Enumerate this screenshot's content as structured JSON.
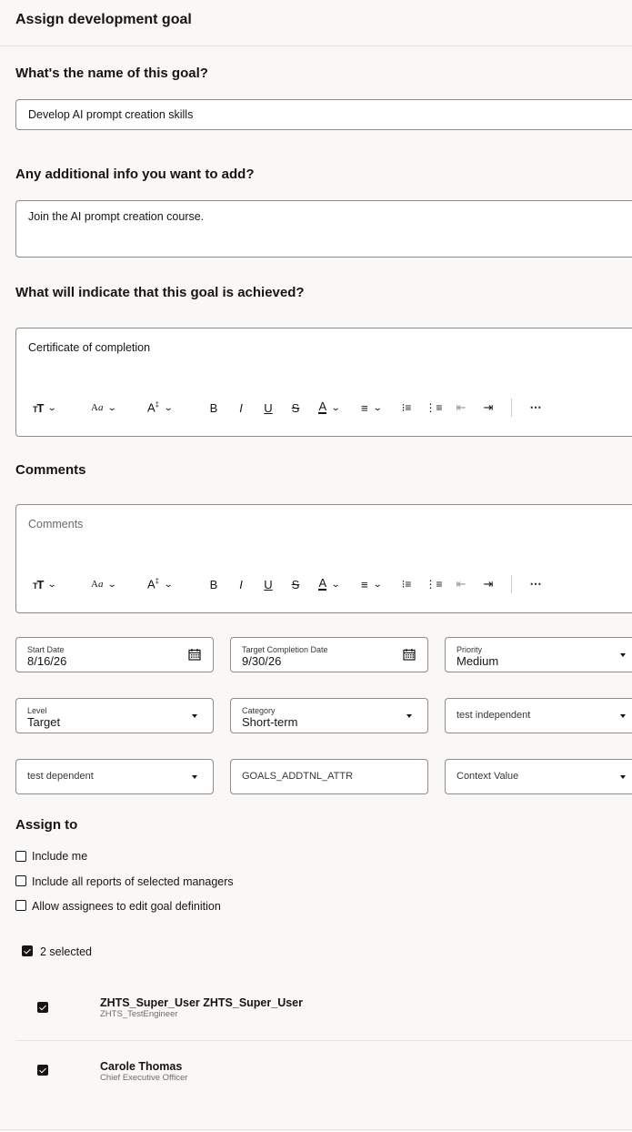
{
  "header": {
    "title": "Assign development goal"
  },
  "goal_name": {
    "question": "What's the name of this goal?",
    "value": "Develop AI prompt creation skills"
  },
  "additional_info": {
    "question": "Any additional info you want to add?",
    "value": "Join the AI prompt creation course."
  },
  "achievement": {
    "question": "What will indicate that this goal is achieved?",
    "value": "Certificate of completion",
    "toolbar": [
      "text-size-icon",
      "font-icon",
      "line-height-icon",
      "bold-icon",
      "italic-icon",
      "underline-icon",
      "strikethrough-icon",
      "font-color-icon",
      "align-icon",
      "bulleted-list-icon",
      "numbered-list-icon",
      "outdent-icon",
      "indent-icon",
      "more-icon"
    ]
  },
  "comments": {
    "title": "Comments",
    "placeholder": "Comments"
  },
  "fields": {
    "start_date": {
      "label": "Start Date",
      "value": "8/16/26"
    },
    "target_date": {
      "label": "Target Completion Date",
      "value": "9/30/26"
    },
    "priority": {
      "label": "Priority",
      "value": "Medium"
    },
    "level": {
      "label": "Level",
      "value": "Target"
    },
    "category": {
      "label": "Category",
      "value": "Short-term"
    },
    "test_independent": {
      "placeholder": "test independent"
    },
    "test_dependent": {
      "placeholder": "test dependent"
    },
    "goals_attr": {
      "placeholder": "GOALS_ADDTNL_ATTR"
    },
    "context_value": {
      "placeholder": "Context Value"
    }
  },
  "assign": {
    "title": "Assign to",
    "include_me": "Include me",
    "include_reports": "Include all reports of selected managers",
    "allow_edit": "Allow assignees to edit goal definition",
    "selected_count": "2 selected",
    "assignees": [
      {
        "name": "ZHTS_Super_User ZHTS_Super_User",
        "role": "ZHTS_TestEngineer"
      },
      {
        "name": "Carole Thomas",
        "role": "Chief Executive Officer"
      }
    ]
  }
}
